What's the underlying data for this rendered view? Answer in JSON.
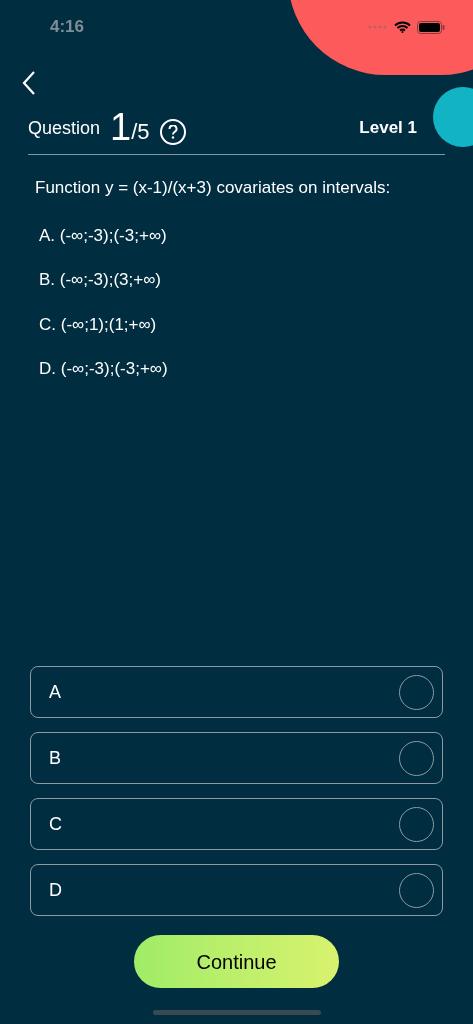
{
  "status_bar": {
    "time": "4:16"
  },
  "header": {
    "label": "Question",
    "current": "1",
    "total": "/5",
    "level": "Level 1"
  },
  "question": {
    "text": "Function y = (x-1)/(x+3) covariates on intervals:",
    "options": [
      "A. (-∞;-3);(-3;+∞)",
      "B. (-∞;-3);(3;+∞)",
      "C. (-∞;1);(1;+∞)",
      "D. (-∞;-3);(-3;+∞)"
    ]
  },
  "answers": [
    {
      "label": "A",
      "selected": false
    },
    {
      "label": "B",
      "selected": false
    },
    {
      "label": "C",
      "selected": false
    },
    {
      "label": "D",
      "selected": false
    }
  ],
  "continue_button": "Continue"
}
